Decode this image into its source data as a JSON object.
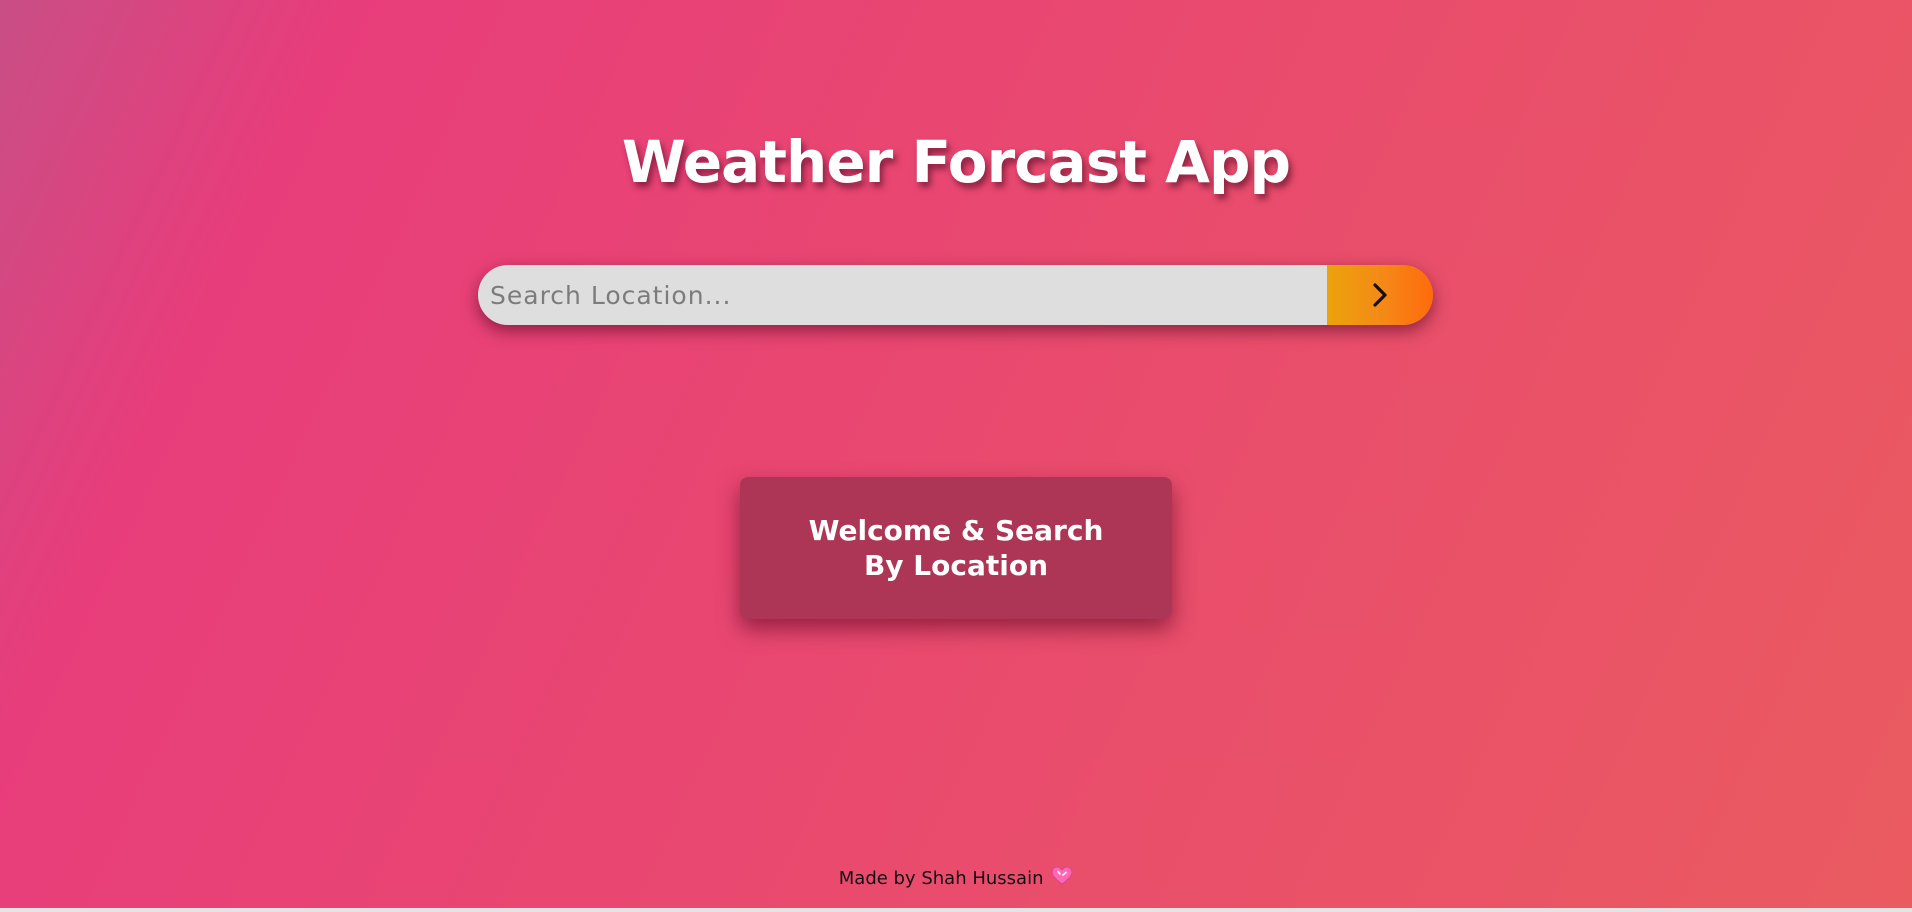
{
  "app": {
    "title": "Weather Forcast App"
  },
  "search": {
    "placeholder": "Search Location...",
    "value": "",
    "button_icon": "chevron-right-icon"
  },
  "welcome": {
    "message": "Welcome & Search By Location"
  },
  "footer": {
    "credit": "Made by Shah Hussain",
    "icon": "heart-icon"
  },
  "colors": {
    "background_start": "#c94e86",
    "background_mid": "#e83d7b",
    "background_end": "#ea5b60",
    "search_field": "#dedede",
    "search_button_start": "#eba30c",
    "search_button_end": "#ff6a0c",
    "card": "#ad3656",
    "title_text": "#ffffff"
  }
}
